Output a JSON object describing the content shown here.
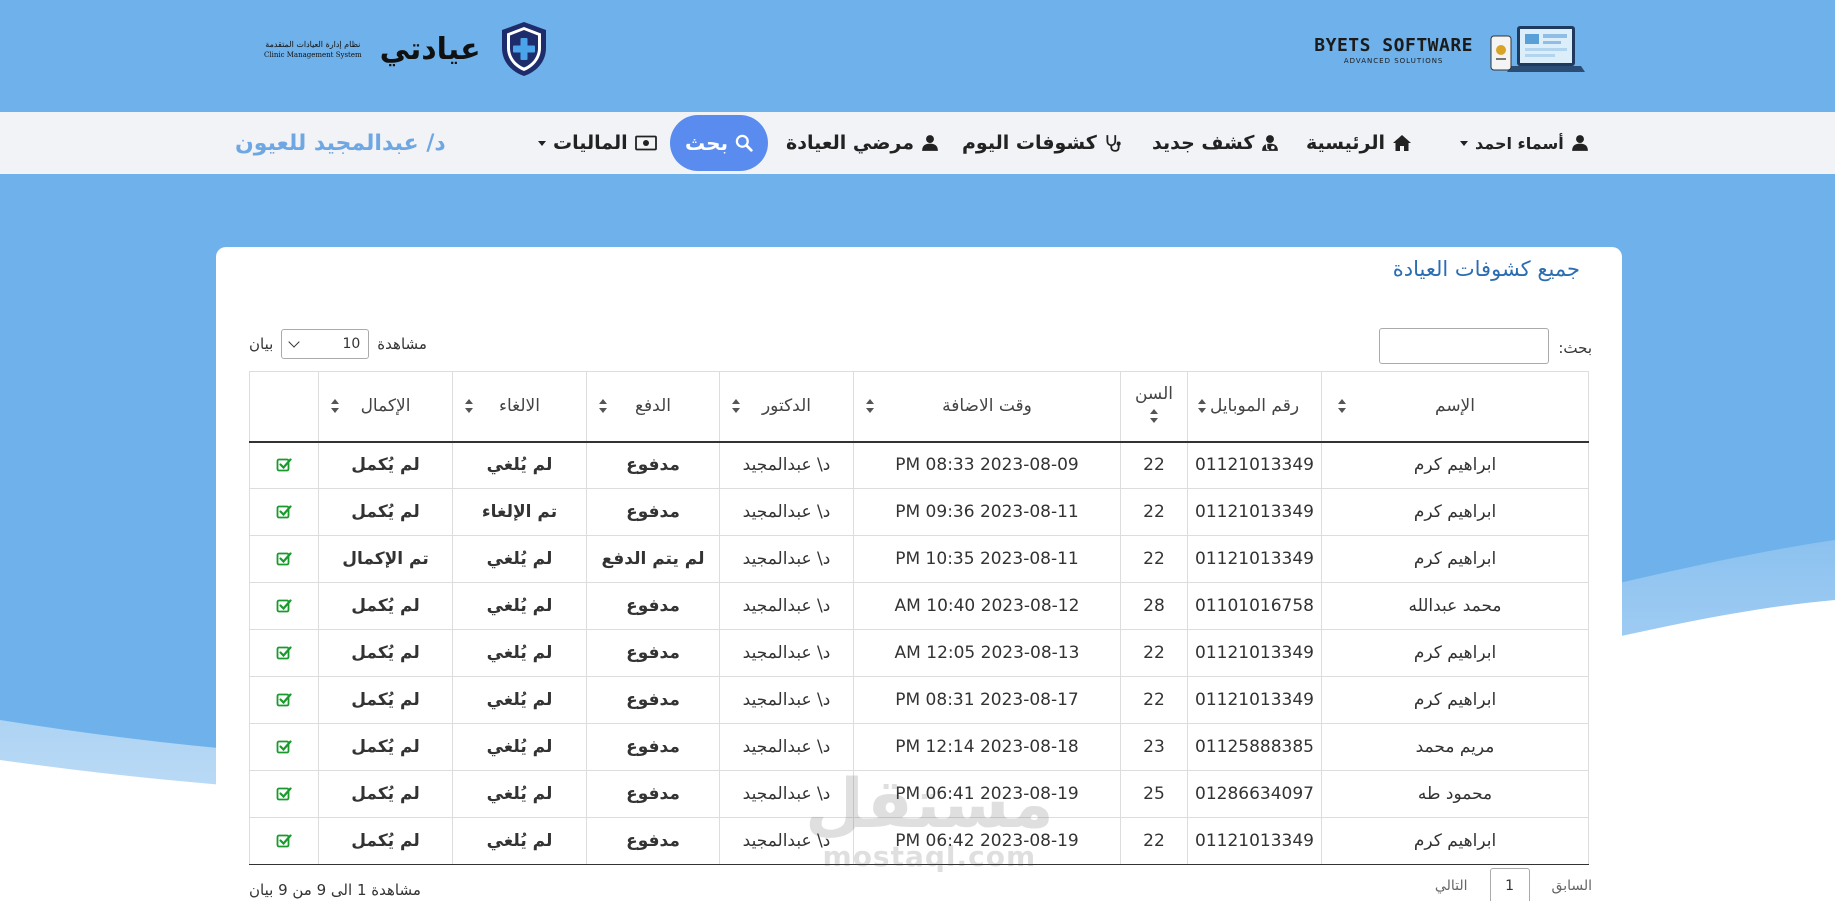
{
  "header": {
    "byets_title": "BYETS SOFTWARE",
    "byets_subtitle": "ADVANCED SOLUTIONS",
    "app_name": "عيادتي",
    "system_name_ar": "نظام إدارة العيادات المتقدمة",
    "system_name_en": "Clinic Management System"
  },
  "nav": {
    "user_menu": "أسماء احمد",
    "home": "الرئيسية",
    "new_exam": "كشف جديد",
    "today_exams": "كشوفات اليوم",
    "clinic_patients": "مرضي العيادة",
    "search": "بحث",
    "finances": "الماليات",
    "doctor": "د/ عبدالمجيد للعيون"
  },
  "card": {
    "title": "جميع كشوفات العيادة",
    "search_label": "بحث:",
    "search_value": "",
    "length_prefix": "مشاهدة",
    "length_value": "10",
    "length_suffix": "بيان"
  },
  "table": {
    "columns": [
      "الإسم",
      "رقم الموبايل",
      "السن",
      "وقت الاضافة",
      "الدكتور",
      "الدفع",
      "الالغاء",
      "الإكمال",
      ""
    ],
    "rows": [
      {
        "name": "ابراهيم كرم",
        "mobile": "01121013349",
        "age": "22",
        "time": "PM 08:33 2023-08-09",
        "doctor": "د\\ عبدالمجيد",
        "payment": "مدفوع",
        "payment_status": "ok",
        "cancel": "لم يُلغي",
        "cancel_status": "ok",
        "complete": "لم يُكمل",
        "complete_status": "bad"
      },
      {
        "name": "ابراهيم كرم",
        "mobile": "01121013349",
        "age": "22",
        "time": "PM 09:36 2023-08-11",
        "doctor": "د\\ عبدالمجيد",
        "payment": "مدفوع",
        "payment_status": "ok",
        "cancel": "تم الإلغاء",
        "cancel_status": "bad",
        "complete": "لم يُكمل",
        "complete_status": "bad"
      },
      {
        "name": "ابراهيم كرم",
        "mobile": "01121013349",
        "age": "22",
        "time": "PM 10:35 2023-08-11",
        "doctor": "د\\ عبدالمجيد",
        "payment": "لم يتم الدفع",
        "payment_status": "bad",
        "cancel": "لم يُلغي",
        "cancel_status": "ok",
        "complete": "تم الإكمال",
        "complete_status": "ok"
      },
      {
        "name": "محمد عبدالله",
        "mobile": "01101016758",
        "age": "28",
        "time": "AM 10:40 2023-08-12",
        "doctor": "د\\ عبدالمجيد",
        "payment": "مدفوع",
        "payment_status": "ok",
        "cancel": "لم يُلغي",
        "cancel_status": "ok",
        "complete": "لم يُكمل",
        "complete_status": "bad"
      },
      {
        "name": "ابراهيم كرم",
        "mobile": "01121013349",
        "age": "22",
        "time": "AM 12:05 2023-08-13",
        "doctor": "د\\ عبدالمجيد",
        "payment": "مدفوع",
        "payment_status": "ok",
        "cancel": "لم يُلغي",
        "cancel_status": "ok",
        "complete": "لم يُكمل",
        "complete_status": "bad"
      },
      {
        "name": "ابراهيم كرم",
        "mobile": "01121013349",
        "age": "22",
        "time": "PM 08:31 2023-08-17",
        "doctor": "د\\ عبدالمجيد",
        "payment": "مدفوع",
        "payment_status": "ok",
        "cancel": "لم يُلغي",
        "cancel_status": "ok",
        "complete": "لم يُكمل",
        "complete_status": "bad"
      },
      {
        "name": "مريم محمد",
        "mobile": "01125888385",
        "age": "23",
        "time": "PM 12:14 2023-08-18",
        "doctor": "د\\ عبدالمجيد",
        "payment": "مدفوع",
        "payment_status": "ok",
        "cancel": "لم يُلغي",
        "cancel_status": "ok",
        "complete": "لم يُكمل",
        "complete_status": "bad"
      },
      {
        "name": "محمود طه",
        "mobile": "01286634097",
        "age": "25",
        "time": "PM 06:41 2023-08-19",
        "doctor": "د\\ عبدالمجيد",
        "payment": "مدفوع",
        "payment_status": "ok",
        "cancel": "لم يُلغي",
        "cancel_status": "ok",
        "complete": "لم يُكمل",
        "complete_status": "bad"
      },
      {
        "name": "ابراهيم كرم",
        "mobile": "01121013349",
        "age": "22",
        "time": "PM 06:42 2023-08-19",
        "doctor": "د\\ عبدالمجيد",
        "payment": "مدفوع",
        "payment_status": "ok",
        "cancel": "لم يُلغي",
        "cancel_status": "ok",
        "complete": "لم يُكمل",
        "complete_status": "bad"
      }
    ]
  },
  "footer": {
    "info": "مشاهدة 1 الى 9 من 9 بيان",
    "prev": "السابق",
    "page": "1",
    "next": "التالي"
  },
  "watermark": {
    "ar": "مستقل",
    "en": "mostaql.com"
  },
  "colors": {
    "header_bg": "#6fb1ea",
    "nav_bg": "#f1f3f7",
    "search_btn": "#5a8cf0",
    "doctor_name": "#6fa7e2",
    "title": "#2a6db3",
    "ok": "#1a9a2c",
    "bad": "#e81818"
  }
}
